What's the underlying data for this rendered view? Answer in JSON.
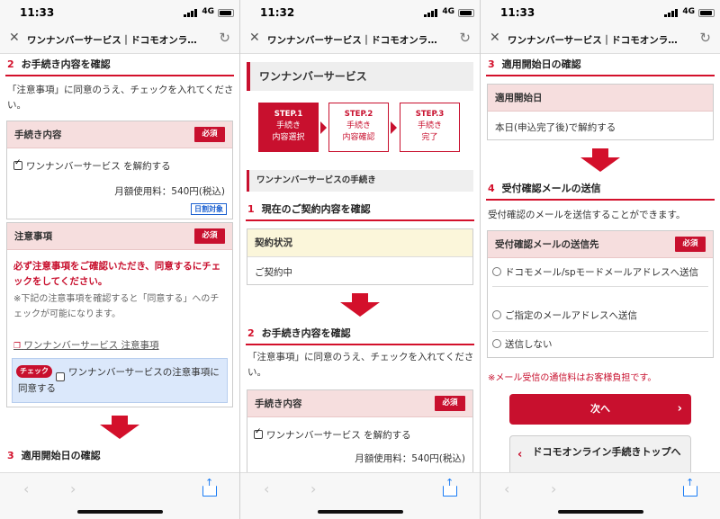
{
  "common": {
    "url_title": "ワンナンバーサービス｜ドコモオンラ…",
    "network": "4G",
    "icons": [
      "close-icon",
      "reload-icon",
      "back-icon",
      "forward-icon",
      "share-icon",
      "link-icon"
    ]
  },
  "screen1": {
    "time": "11:33",
    "sec2_num": "2",
    "sec2_title": "お手続き内容を確認",
    "sec2_text": "「注意事項」に同意のうえ、チェックを入れてください。",
    "proc_head": "手続き内容",
    "required": "必須",
    "service_check": "ワンナンバーサービス を解約する",
    "fee": "月額使用料：540円(税込)",
    "daily_badge": "日割対象",
    "notes_head": "注意事項",
    "notes_warning": "必ず注意事項をご確認いただき、同意するにチェックをしてください。",
    "notes_sub": "※下記の注意事項を確認すると「同意する」へのチェックが可能になります。",
    "notes_link": "ワンナンバーサービス 注意事項",
    "check_tag": "チェック",
    "agree_text": "ワンナンバーサービスの注意事項に同意する",
    "sec3_num": "3",
    "sec3_title": "適用開始日の確認"
  },
  "screen2": {
    "time": "11:32",
    "service_title": "ワンナンバーサービス",
    "steps": [
      {
        "label": "STEP.1",
        "line1": "手続き",
        "line2": "内容選択"
      },
      {
        "label": "STEP.2",
        "line1": "手続き",
        "line2": "内容確認"
      },
      {
        "label": "STEP.3",
        "line1": "手続き",
        "line2": "完了"
      }
    ],
    "proc_title": "ワンナンバーサービスの手続き",
    "sec1_num": "1",
    "sec1_title": "現在のご契約内容を確認",
    "contract_head": "契約状況",
    "contract_value": "ご契約中",
    "sec2_num": "2",
    "sec2_title": "お手続き内容を確認",
    "sec2_text": "「注意事項」に同意のうえ、チェックを入れてください。",
    "proc_head": "手続き内容",
    "required": "必須",
    "service_check": "ワンナンバーサービス を解約する",
    "fee": "月額使用料：540円(税込)"
  },
  "screen3": {
    "time": "11:33",
    "sec3_num": "3",
    "sec3_title": "適用開始日の確認",
    "start_head": "適用開始日",
    "start_value": "本日(申込完了後)で解約する",
    "sec4_num": "4",
    "sec4_title": "受付確認メールの送信",
    "sec4_text": "受付確認のメールを送信することができます。",
    "mail_head": "受付確認メールの送信先",
    "required": "必須",
    "opt1": "ドコモメール/spモードメールアドレスへ送信",
    "opt2": "ご指定のメールアドレスへ送信",
    "opt3": "送信しない",
    "note": "※メール受信の通信料はお客様負担です。",
    "next_label": "次へ",
    "top_label": "ドコモオンライン手続きトップへ"
  },
  "colors": {
    "accent": "#c8102e",
    "pink": "#f6dede",
    "blue_agree": "#dbe8fb"
  }
}
